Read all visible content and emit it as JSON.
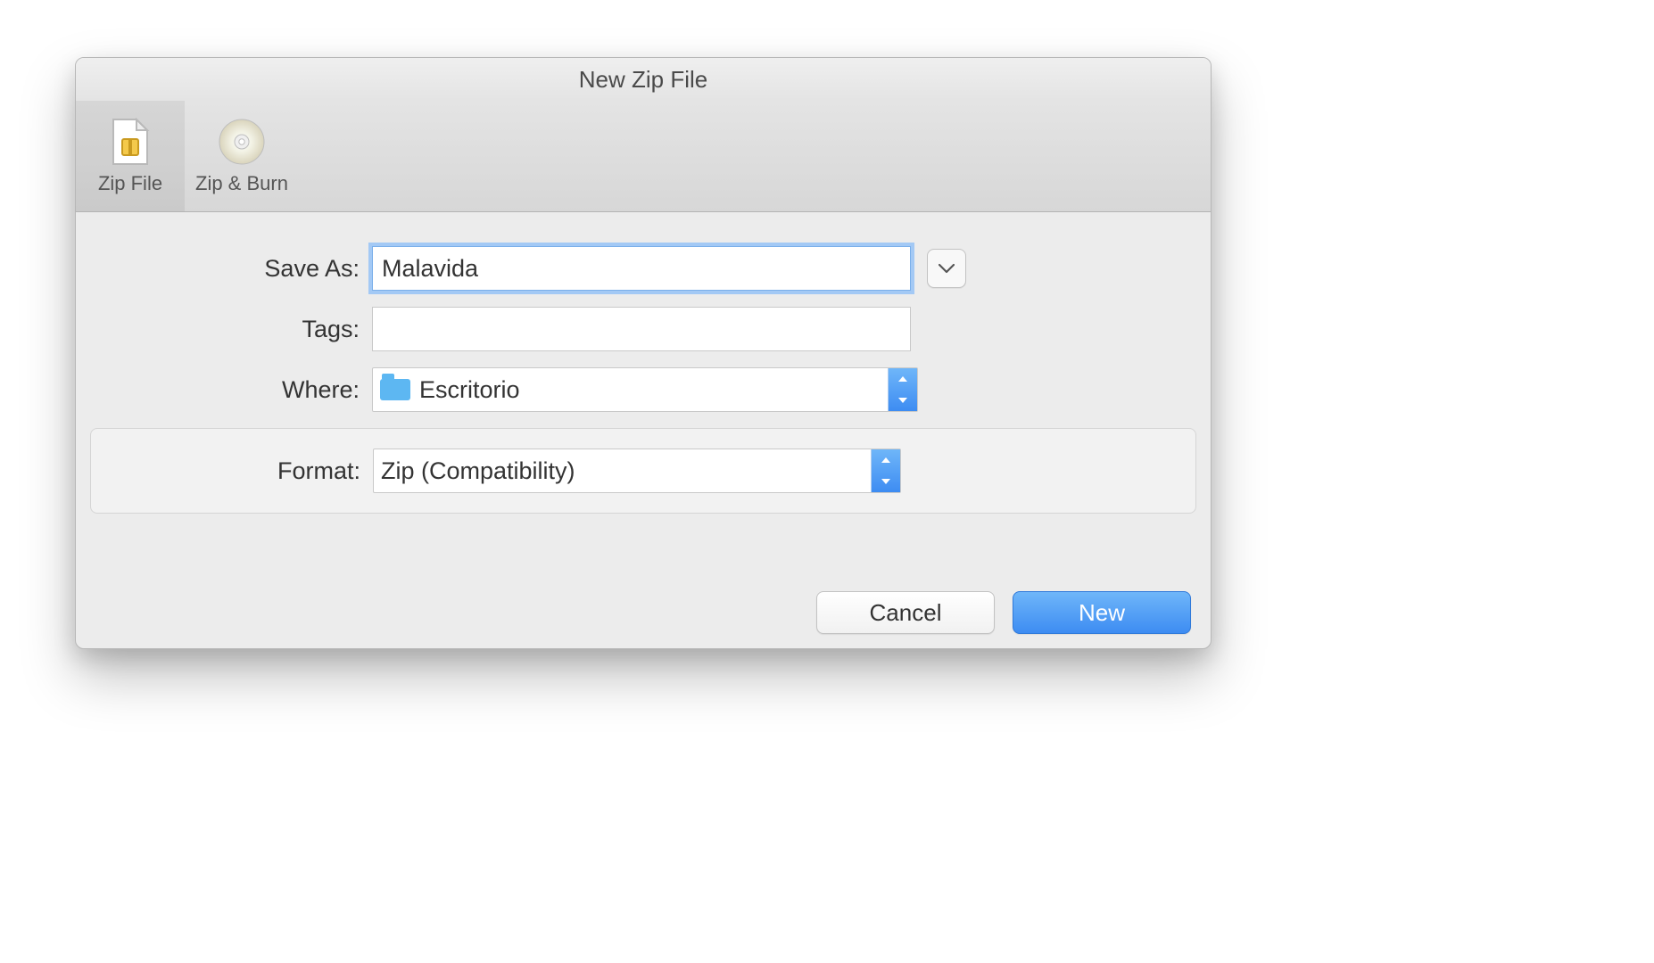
{
  "dialog": {
    "title": "New Zip File",
    "toolbar_items": [
      {
        "label": "Zip File",
        "icon": "zip-file-icon",
        "active": true
      },
      {
        "label": "Zip & Burn",
        "icon": "disc-icon",
        "active": false
      }
    ]
  },
  "form": {
    "save_as": {
      "label": "Save As:",
      "value": "Malavida"
    },
    "tags": {
      "label": "Tags:",
      "value": ""
    },
    "where": {
      "label": "Where:",
      "value": "Escritorio"
    },
    "format": {
      "label": "Format:",
      "value": "Zip (Compatibility)"
    }
  },
  "buttons": {
    "cancel": "Cancel",
    "new": "New"
  }
}
